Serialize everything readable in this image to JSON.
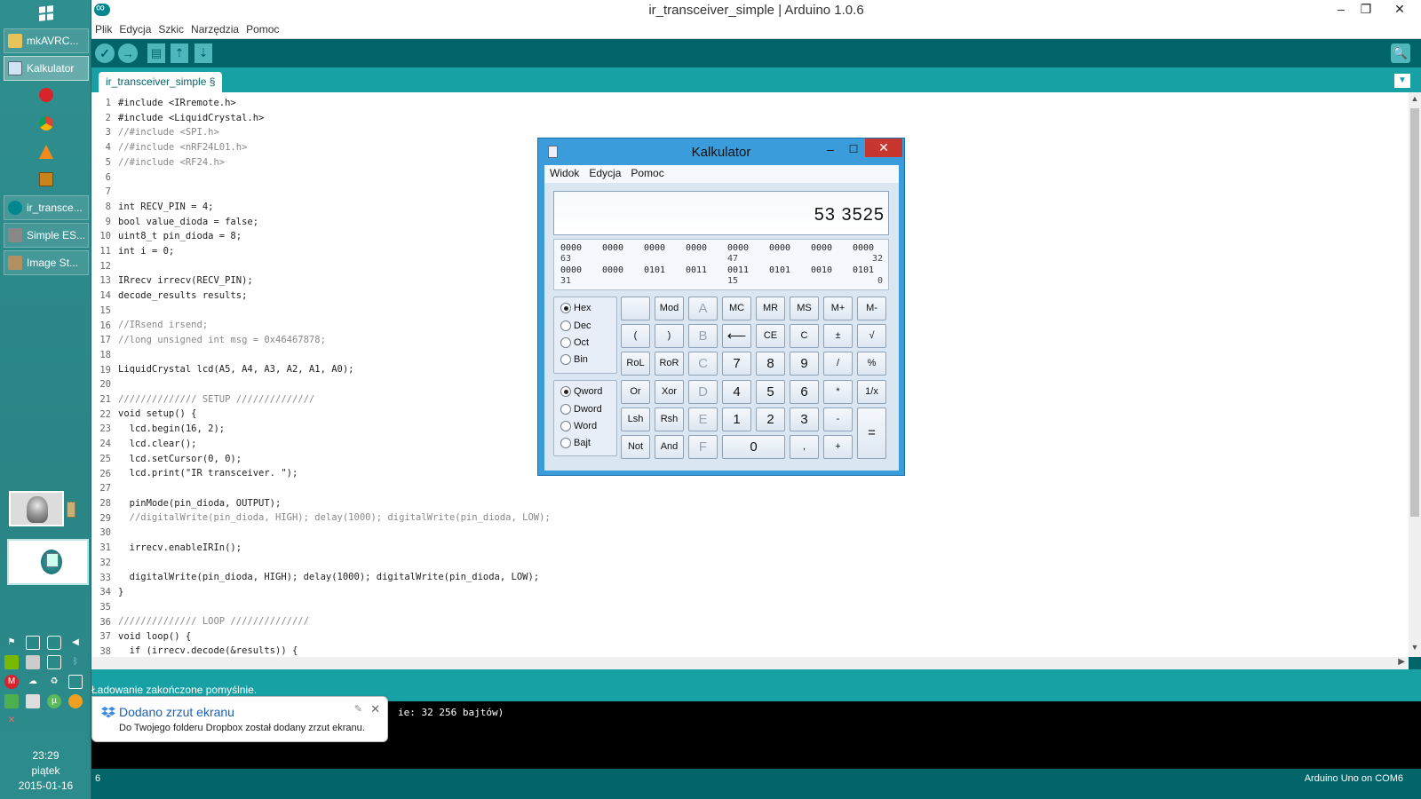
{
  "taskbar": {
    "items": [
      {
        "label": "mkAVRC..."
      },
      {
        "label": "Kalkulator"
      },
      {
        "label": "ir_transce..."
      },
      {
        "label": "Simple ES..."
      },
      {
        "label": "Image St..."
      }
    ],
    "clock": {
      "time": "23:29",
      "day": "piątek",
      "date": "2015-01-16"
    }
  },
  "arduino": {
    "title": "ir_transceiver_simple | Arduino 1.0.6",
    "menu": [
      "Plik",
      "Edycja",
      "Szkic",
      "Narzędzia",
      "Pomoc"
    ],
    "toolbar": {
      "verify": "✓",
      "upload": "→",
      "new": "▤",
      "open": "⇡",
      "save": "⇣",
      "serial": "🔍"
    },
    "tab": "ir_transceiver_simple §",
    "status": "Ładowanie zakończone pomyślnie.",
    "console": "ie: 32 256 bajtów)",
    "line_indicator": "6",
    "board": "Arduino Uno on COM6",
    "code_lines": [
      "#include <IRremote.h>",
      "#include <LiquidCrystal.h>",
      "//#include <SPI.h>",
      "//#include <nRF24L01.h>",
      "//#include <RF24.h>",
      "",
      "",
      "int RECV_PIN = 4;",
      "bool value_dioda = false;",
      "uint8_t pin_dioda = 8;",
      "int i = 0;",
      "",
      "IRrecv irrecv(RECV_PIN);",
      "decode_results results;",
      "",
      "//IRsend irsend;",
      "//long unsigned int msg = 0x46467878;",
      "",
      "LiquidCrystal lcd(A5, A4, A3, A2, A1, A0);",
      "",
      "////////////// SETUP //////////////",
      "void setup() {",
      "  lcd.begin(16, 2);",
      "  lcd.clear();",
      "  lcd.setCursor(0, 0);",
      "  lcd.print(\"IR transceiver. \");",
      "",
      "  pinMode(pin_dioda, OUTPUT);",
      "  //digitalWrite(pin_dioda, HIGH); delay(1000); digitalWrite(pin_dioda, LOW);",
      "",
      "  irrecv.enableIRIn();",
      "",
      "  digitalWrite(pin_dioda, HIGH); delay(1000); digitalWrite(pin_dioda, LOW);",
      "}",
      "",
      "////////////// LOOP //////////////",
      "void loop() {",
      "  if (irrecv.decode(&results)) {"
    ]
  },
  "toast": {
    "title": "Dodano zrzut ekranu",
    "body": "Do Twojego folderu Dropbox został dodany zrzut ekranu."
  },
  "calculator": {
    "title": "Kalkulator",
    "menu": [
      "Widok",
      "Edycja",
      "Pomoc"
    ],
    "display": "53 3525",
    "bits_row1": [
      "0000",
      "0000",
      "0000",
      "0000",
      "0000",
      "0000",
      "0000",
      "0000"
    ],
    "bits_row2": [
      "0000",
      "0000",
      "0101",
      "0011",
      "0011",
      "0101",
      "0010",
      "0101"
    ],
    "bit_labels": {
      "r1_left": "63",
      "r1_mid": "47",
      "r1_right": "32",
      "r2_left": "31",
      "r2_mid": "15",
      "r2_right": "0"
    },
    "radix": [
      "Hex",
      "Dec",
      "Oct",
      "Bin"
    ],
    "radix_selected": "Hex",
    "word": [
      "Qword",
      "Dword",
      "Word",
      "Bajt"
    ],
    "word_selected": "Qword",
    "keys": {
      "r1": [
        "",
        "Mod",
        "A",
        "MC",
        "MR",
        "MS",
        "M+",
        "M-"
      ],
      "r2": [
        "(",
        ")",
        "B",
        "⟵",
        "CE",
        "C",
        "±",
        "√"
      ],
      "r3": [
        "RoL",
        "RoR",
        "C",
        "7",
        "8",
        "9",
        "/",
        "%"
      ],
      "r4": [
        "Or",
        "Xor",
        "D",
        "4",
        "5",
        "6",
        "*",
        "1/x"
      ],
      "r5": [
        "Lsh",
        "Rsh",
        "E",
        "1",
        "2",
        "3",
        "-"
      ],
      "r6": [
        "Not",
        "And",
        "F",
        "0",
        ",",
        "+"
      ],
      "equals": "="
    }
  }
}
